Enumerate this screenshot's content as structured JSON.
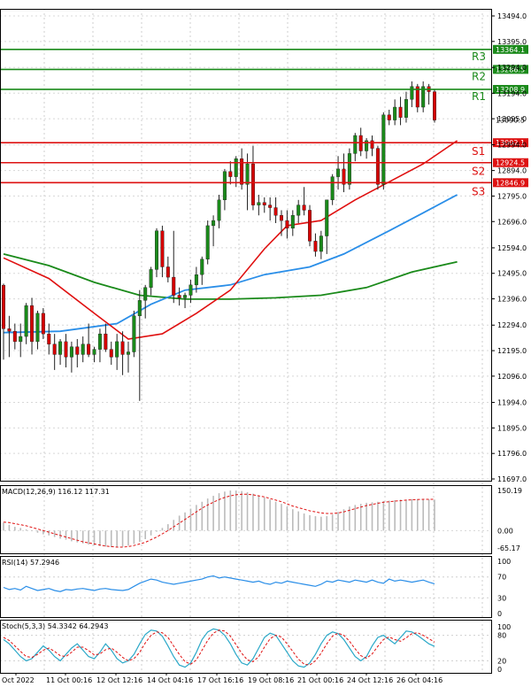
{
  "chart_data": {
    "type": "candlestick",
    "y_ticks": [
      "13494.0",
      "13395.0",
      "13294.0",
      "13194.0",
      "13095.0",
      "12994.0",
      "12894.0",
      "12795.0",
      "12696.0",
      "12594.0",
      "12495.0",
      "12396.0",
      "12294.0",
      "12195.0",
      "12096.0",
      "11994.0",
      "11895.0",
      "11796.0",
      "11697.0"
    ],
    "x_tick_labels": [
      "Oct 2022",
      "11 Oct 00:16",
      "12 Oct 12:16",
      "14 Oct 04:16",
      "17 Oct 16:16",
      "19 Oct 08:16",
      "21 Oct 00:16",
      "24 Oct 12:16",
      "26 Oct 04:16"
    ],
    "ylim": [
      11697,
      13560
    ],
    "colors": {
      "bull": "#1a8a1a",
      "bear": "#d40000",
      "resistance": "#1a8a1a",
      "support": "#dd1111",
      "ma_fast": "#e01010",
      "ma_mid": "#2a8ee8",
      "ma_slow": "#1a8a1a",
      "macd_hist": "#bbbbbb",
      "macd_signal": "#e01010",
      "rsi": "#2a8ee8",
      "stoch_main": "#2aa8c8",
      "stoch_signal": "#e01010"
    },
    "levels": [
      {
        "name": "R3",
        "value": 13364.1,
        "label": "13364.1",
        "kind": "resistance"
      },
      {
        "name": "R2",
        "value": 13286.5,
        "label": "13286.5",
        "kind": "resistance"
      },
      {
        "name": "R1",
        "value": 13208.9,
        "label": "13208.9",
        "kind": "resistance"
      },
      {
        "name": "S1",
        "value": 13002.1,
        "label": "13002.1",
        "kind": "support"
      },
      {
        "name": "S2",
        "value": 12924.5,
        "label": "12924.5",
        "kind": "support"
      },
      {
        "name": "S3",
        "value": 12846.9,
        "label": "12846.9",
        "kind": "support"
      }
    ],
    "current_price": {
      "value": 13090.5,
      "label": "13090.5"
    },
    "candles": [
      [
        12449,
        12455,
        12160,
        12280
      ],
      [
        12280,
        12330,
        12170,
        12270
      ],
      [
        12270,
        12300,
        12200,
        12230
      ],
      [
        12230,
        12300,
        12170,
        12250
      ],
      [
        12250,
        12380,
        12220,
        12370
      ],
      [
        12370,
        12400,
        12180,
        12230
      ],
      [
        12230,
        12350,
        12200,
        12340
      ],
      [
        12340,
        12360,
        12240,
        12260
      ],
      [
        12260,
        12300,
        12180,
        12220
      ],
      [
        12220,
        12260,
        12120,
        12180
      ],
      [
        12180,
        12240,
        12140,
        12230
      ],
      [
        12230,
        12260,
        12130,
        12170
      ],
      [
        12170,
        12230,
        12110,
        12210
      ],
      [
        12210,
        12240,
        12130,
        12180
      ],
      [
        12180,
        12250,
        12150,
        12220
      ],
      [
        12220,
        12300,
        12170,
        12180
      ],
      [
        12180,
        12210,
        12150,
        12200
      ],
      [
        12200,
        12280,
        12150,
        12260
      ],
      [
        12260,
        12300,
        12190,
        12200
      ],
      [
        12200,
        12230,
        12140,
        12170
      ],
      [
        12170,
        12260,
        12120,
        12230
      ],
      [
        12230,
        12270,
        12100,
        12180
      ],
      [
        12180,
        12230,
        12110,
        12190
      ],
      [
        12190,
        12350,
        12170,
        12330
      ],
      [
        12330,
        12430,
        12000,
        12390
      ],
      [
        12390,
        12450,
        12320,
        12440
      ],
      [
        12440,
        12520,
        12410,
        12510
      ],
      [
        12510,
        12670,
        12480,
        12660
      ],
      [
        12660,
        12680,
        12480,
        12520
      ],
      [
        12520,
        12560,
        12460,
        12480
      ],
      [
        12480,
        12660,
        12380,
        12410
      ],
      [
        12410,
        12440,
        12370,
        12400
      ],
      [
        12400,
        12420,
        12360,
        12410
      ],
      [
        12410,
        12470,
        12380,
        12450
      ],
      [
        12450,
        12520,
        12420,
        12490
      ],
      [
        12490,
        12560,
        12450,
        12550
      ],
      [
        12550,
        12700,
        12530,
        12680
      ],
      [
        12680,
        12720,
        12600,
        12700
      ],
      [
        12700,
        12800,
        12670,
        12780
      ],
      [
        12780,
        12900,
        12740,
        12890
      ],
      [
        12890,
        12930,
        12840,
        12870
      ],
      [
        12870,
        12950,
        12830,
        12940
      ],
      [
        12940,
        12980,
        12820,
        12840
      ],
      [
        12840,
        12960,
        12740,
        12920
      ],
      [
        12920,
        12990,
        12740,
        12760
      ],
      [
        12760,
        12800,
        12720,
        12770
      ],
      [
        12770,
        12790,
        12730,
        12760
      ],
      [
        12760,
        12790,
        12700,
        12750
      ],
      [
        12750,
        12790,
        12690,
        12720
      ],
      [
        12720,
        12740,
        12640,
        12700
      ],
      [
        12700,
        12740,
        12630,
        12670
      ],
      [
        12670,
        12740,
        12640,
        12720
      ],
      [
        12720,
        12780,
        12690,
        12760
      ],
      [
        12760,
        12830,
        12720,
        12740
      ],
      [
        12740,
        12760,
        12600,
        12620
      ],
      [
        12620,
        12650,
        12560,
        12580
      ],
      [
        12580,
        12660,
        12550,
        12640
      ],
      [
        12640,
        12760,
        12570,
        12780
      ],
      [
        12780,
        12880,
        12760,
        12870
      ],
      [
        12870,
        12950,
        12820,
        12900
      ],
      [
        12900,
        12960,
        12810,
        12840
      ],
      [
        12840,
        12980,
        12820,
        12960
      ],
      [
        12960,
        13040,
        12930,
        13030
      ],
      [
        13030,
        13060,
        12950,
        12970
      ],
      [
        12970,
        13020,
        12940,
        13010
      ],
      [
        13010,
        13030,
        12950,
        12980
      ],
      [
        12980,
        12990,
        12820,
        12840
      ],
      [
        12840,
        13120,
        12820,
        13110
      ],
      [
        13110,
        13130,
        13070,
        13090
      ],
      [
        13090,
        13170,
        13070,
        13140
      ],
      [
        13140,
        13180,
        13070,
        13100
      ],
      [
        13100,
        13200,
        13080,
        13170
      ],
      [
        13170,
        13240,
        13140,
        13220
      ],
      [
        13220,
        13230,
        13120,
        13140
      ],
      [
        13140,
        13240,
        13120,
        13220
      ],
      [
        13220,
        13230,
        13150,
        13200
      ],
      [
        13200,
        13210,
        13080,
        13090
      ]
    ],
    "ma_fast": [
      [
        0,
        12555
      ],
      [
        8,
        12475
      ],
      [
        16,
        12340
      ],
      [
        22,
        12240
      ],
      [
        28,
        12260
      ],
      [
        34,
        12340
      ],
      [
        40,
        12430
      ],
      [
        46,
        12590
      ],
      [
        50,
        12680
      ],
      [
        56,
        12700
      ],
      [
        62,
        12780
      ],
      [
        68,
        12850
      ],
      [
        74,
        12920
      ],
      [
        80,
        13010
      ]
    ],
    "ma_mid": [
      [
        0,
        12265
      ],
      [
        10,
        12270
      ],
      [
        20,
        12300
      ],
      [
        26,
        12375
      ],
      [
        32,
        12430
      ],
      [
        40,
        12450
      ],
      [
        46,
        12490
      ],
      [
        54,
        12520
      ],
      [
        60,
        12570
      ],
      [
        68,
        12660
      ],
      [
        74,
        12730
      ],
      [
        80,
        12800
      ]
    ],
    "ma_slow": [
      [
        0,
        12570
      ],
      [
        8,
        12525
      ],
      [
        16,
        12460
      ],
      [
        24,
        12410
      ],
      [
        32,
        12395
      ],
      [
        40,
        12395
      ],
      [
        48,
        12400
      ],
      [
        56,
        12410
      ],
      [
        64,
        12440
      ],
      [
        72,
        12500
      ],
      [
        80,
        12540
      ]
    ],
    "macd": {
      "label": "MACD(12,26,9) 116.12 117.31",
      "ticks": [
        "150.19",
        "0.00",
        "-65.17"
      ],
      "range": [
        -65.17,
        150.19
      ],
      "histogram": [
        30,
        22,
        14,
        10,
        4,
        -2,
        -8,
        -14,
        -18,
        -24,
        -30,
        -34,
        -40,
        -44,
        -48,
        -52,
        -56,
        -58,
        -60,
        -62,
        -62,
        -60,
        -56,
        -50,
        -42,
        -32,
        -18,
        -4,
        10,
        24,
        40,
        56,
        68,
        82,
        96,
        108,
        120,
        130,
        140,
        146,
        150,
        150,
        148,
        144,
        138,
        132,
        124,
        116,
        108,
        100,
        90,
        80,
        72,
        64,
        58,
        54,
        52,
        54,
        60,
        70,
        80,
        90,
        96,
        100,
        104,
        106,
        108,
        110,
        112,
        114,
        116,
        116,
        118,
        118,
        118,
        117,
        116
      ],
      "signal": [
        32,
        30,
        26,
        22,
        18,
        12,
        6,
        0,
        -6,
        -12,
        -18,
        -24,
        -30,
        -36,
        -42,
        -46,
        -50,
        -54,
        -58,
        -60,
        -62,
        -62,
        -60,
        -56,
        -50,
        -44,
        -34,
        -24,
        -12,
        0,
        14,
        28,
        42,
        56,
        70,
        84,
        96,
        106,
        116,
        124,
        130,
        134,
        136,
        136,
        134,
        130,
        126,
        120,
        114,
        108,
        100,
        92,
        86,
        80,
        74,
        70,
        66,
        64,
        64,
        66,
        70,
        76,
        82,
        88,
        94,
        98,
        102,
        106,
        108,
        110,
        112,
        114,
        115,
        116,
        117,
        117,
        117
      ]
    },
    "rsi": {
      "label": "RSI(14) 57.2946",
      "ticks": [
        "100",
        "70",
        "30",
        "0"
      ],
      "range": [
        0,
        100
      ],
      "values": [
        50,
        46,
        48,
        45,
        52,
        48,
        44,
        46,
        48,
        44,
        42,
        46,
        45,
        47,
        48,
        46,
        44,
        47,
        48,
        46,
        45,
        44,
        46,
        52,
        58,
        62,
        66,
        64,
        60,
        58,
        56,
        58,
        60,
        62,
        64,
        66,
        70,
        72,
        68,
        70,
        68,
        66,
        64,
        62,
        60,
        62,
        58,
        56,
        60,
        58,
        62,
        60,
        58,
        56,
        54,
        52,
        56,
        62,
        60,
        64,
        62,
        60,
        64,
        62,
        60,
        64,
        60,
        58,
        66,
        62,
        64,
        62,
        60,
        62,
        64,
        60,
        57
      ]
    },
    "stoch": {
      "label": "Stoch(5,3,3) 54.3342 64.2943",
      "ticks": [
        "100",
        "80",
        "20",
        "0"
      ],
      "range": [
        0,
        100
      ],
      "main": [
        70,
        60,
        45,
        30,
        20,
        25,
        40,
        55,
        45,
        30,
        20,
        35,
        50,
        60,
        45,
        30,
        25,
        40,
        60,
        45,
        25,
        15,
        20,
        35,
        60,
        82,
        92,
        90,
        78,
        55,
        30,
        10,
        5,
        15,
        40,
        70,
        88,
        95,
        92,
        80,
        60,
        35,
        15,
        10,
        25,
        50,
        75,
        85,
        80,
        60,
        40,
        20,
        8,
        5,
        15,
        35,
        60,
        80,
        88,
        84,
        70,
        50,
        30,
        20,
        30,
        55,
        75,
        80,
        70,
        60,
        75,
        90,
        88,
        80,
        70,
        60,
        54
      ],
      "signal": [
        75,
        68,
        55,
        42,
        30,
        28,
        35,
        45,
        50,
        42,
        32,
        30,
        40,
        52,
        52,
        44,
        34,
        36,
        46,
        50,
        40,
        28,
        20,
        25,
        40,
        62,
        80,
        88,
        86,
        75,
        55,
        35,
        18,
        12,
        22,
        45,
        68,
        85,
        92,
        90,
        78,
        58,
        38,
        22,
        18,
        30,
        52,
        72,
        80,
        76,
        60,
        42,
        24,
        12,
        10,
        20,
        38,
        60,
        78,
        85,
        80,
        66,
        48,
        32,
        26,
        36,
        54,
        70,
        76,
        70,
        66,
        74,
        84,
        86,
        80,
        72,
        64
      ]
    }
  }
}
